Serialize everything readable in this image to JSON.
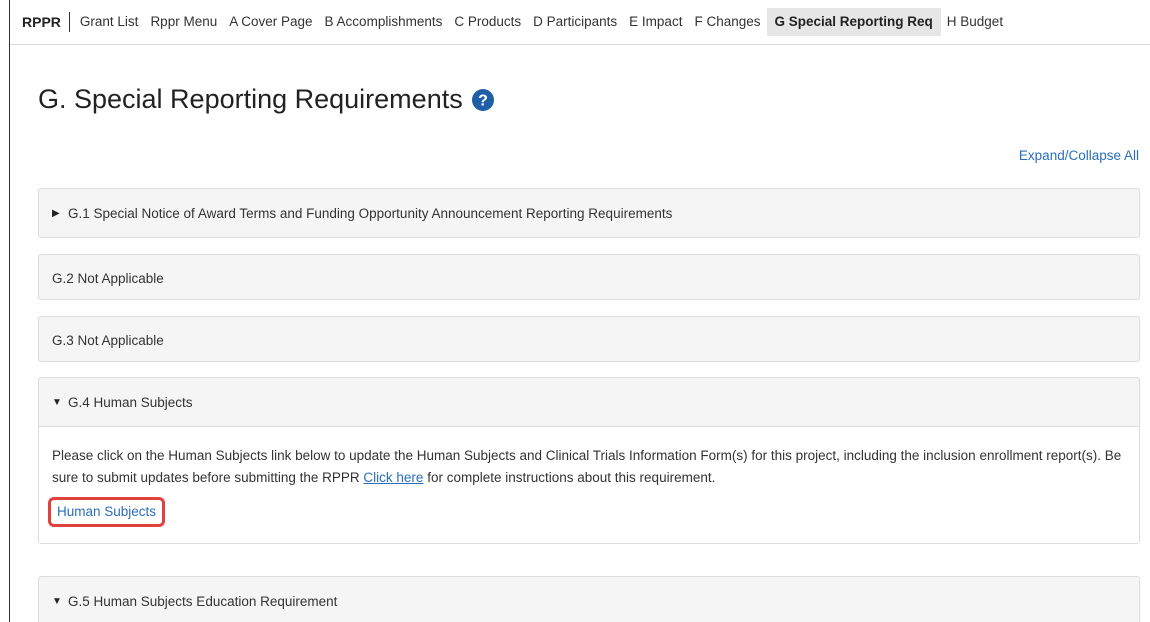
{
  "nav": {
    "brand": "RPPR",
    "items": [
      {
        "label": "Grant List",
        "active": false
      },
      {
        "label": "Rppr Menu",
        "active": false
      },
      {
        "label": "A Cover Page",
        "active": false
      },
      {
        "label": "B Accomplishments",
        "active": false
      },
      {
        "label": "C Products",
        "active": false
      },
      {
        "label": "D Participants",
        "active": false
      },
      {
        "label": "E Impact",
        "active": false
      },
      {
        "label": "F Changes",
        "active": false
      },
      {
        "label": "G Special Reporting Req",
        "active": true
      },
      {
        "label": "H Budget",
        "active": false
      }
    ]
  },
  "page": {
    "title": "G. Special Reporting Requirements",
    "expand_all": "Expand/Collapse All"
  },
  "sections": {
    "g1": {
      "title": "G.1 Special Notice of Award Terms and Funding Opportunity Announcement Reporting Requirements",
      "caret": "right"
    },
    "g2": {
      "title": "G.2 Not Applicable"
    },
    "g3": {
      "title": "G.3 Not Applicable"
    },
    "g4": {
      "title": "G.4 Human Subjects",
      "caret": "down",
      "body_text_1": "Please click on the Human Subjects link below to update the Human Subjects and Clinical Trials Information Form(s) for this project, including the inclusion enrollment report(s). Be sure to submit updates before submitting the RPPR ",
      "click_here": "Click here",
      "body_text_2": " for complete instructions about this requirement.",
      "link": "Human Subjects"
    },
    "g5": {
      "title": "G.5 Human Subjects Education Requirement",
      "caret": "down"
    }
  },
  "colors": {
    "link": "#2a6ebb",
    "highlight": "#e0433f",
    "help_icon": "#1f5fa8"
  }
}
